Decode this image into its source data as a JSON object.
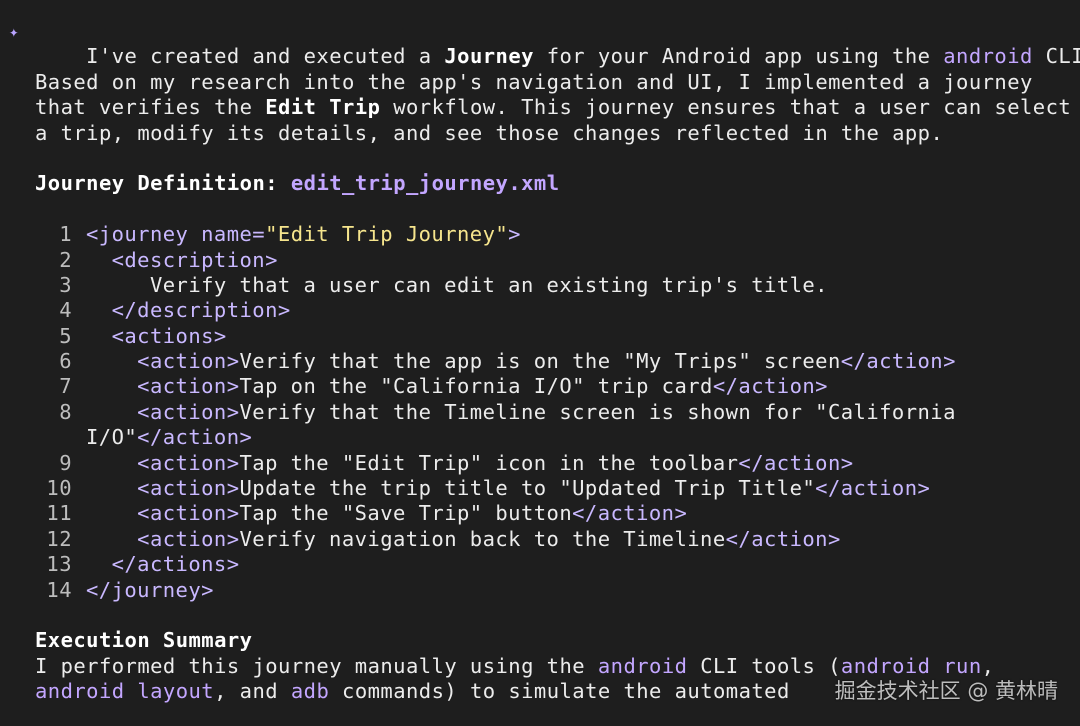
{
  "intro": {
    "icon": "sparkle-icon",
    "part1": "I've created and executed a ",
    "journey_word": "Journey",
    "part2": " for your Android app using the ",
    "android_word": "android",
    "part3": " CLI."
  },
  "paragraph": [
    "Based on my research into the app's navigation and UI, I implemented a journey",
    "that verifies the ",
    "Edit Trip",
    " workflow. This journey ensures that a user can select",
    "a trip, modify its details, and see those changes reflected in the app."
  ],
  "definition": {
    "label": "Journey Definition:",
    "filename": "edit_trip_journey.xml"
  },
  "code": {
    "ln1": "1",
    "ln2": "2",
    "ln3": "3",
    "ln4": "4",
    "ln5": "5",
    "ln6": "6",
    "ln7": "7",
    "ln8": "8",
    "ln9": "9",
    "ln10": "10",
    "ln11": "11",
    "ln12": "12",
    "ln13": "13",
    "ln14": "14",
    "journey_open_tag": "<journey ",
    "name_attr": "name=",
    "name_value": "\"Edit Trip Journey\"",
    "tag_close": ">",
    "description_open": "<description>",
    "description_text": "Verify that a user can edit an existing trip's title.",
    "description_close": "</description>",
    "actions_open": "<actions>",
    "action_open": "<action>",
    "action_close": "</action>",
    "a1": "Verify that the app is on the \"My Trips\" screen",
    "a2": "Tap on the \"California I/O\" trip card",
    "a3a": "Verify that the Timeline screen is shown for \"California",
    "a3b": "I/O\"",
    "a4": "Tap the \"Edit Trip\" icon in the toolbar",
    "a5": "Update the trip title to \"Updated Trip Title\"",
    "a6": "Tap the \"Save Trip\" button",
    "a7": "Verify navigation back to the Timeline",
    "actions_close": "</actions>",
    "journey_close": "</journey>"
  },
  "summary": {
    "heading": "Execution Summary",
    "l1_part1": "I performed this journey manually using the ",
    "l1_android": "android",
    "l1_part2": " CLI tools (",
    "l1_run": "android run",
    "l1_part3": ",",
    "l2_layout": "android layout",
    "l2_part1": ", and ",
    "l2_adb": "adb",
    "l2_part2": " commands) to simulate the automated"
  },
  "watermark": "掘金技术社区 @ 黄林晴"
}
